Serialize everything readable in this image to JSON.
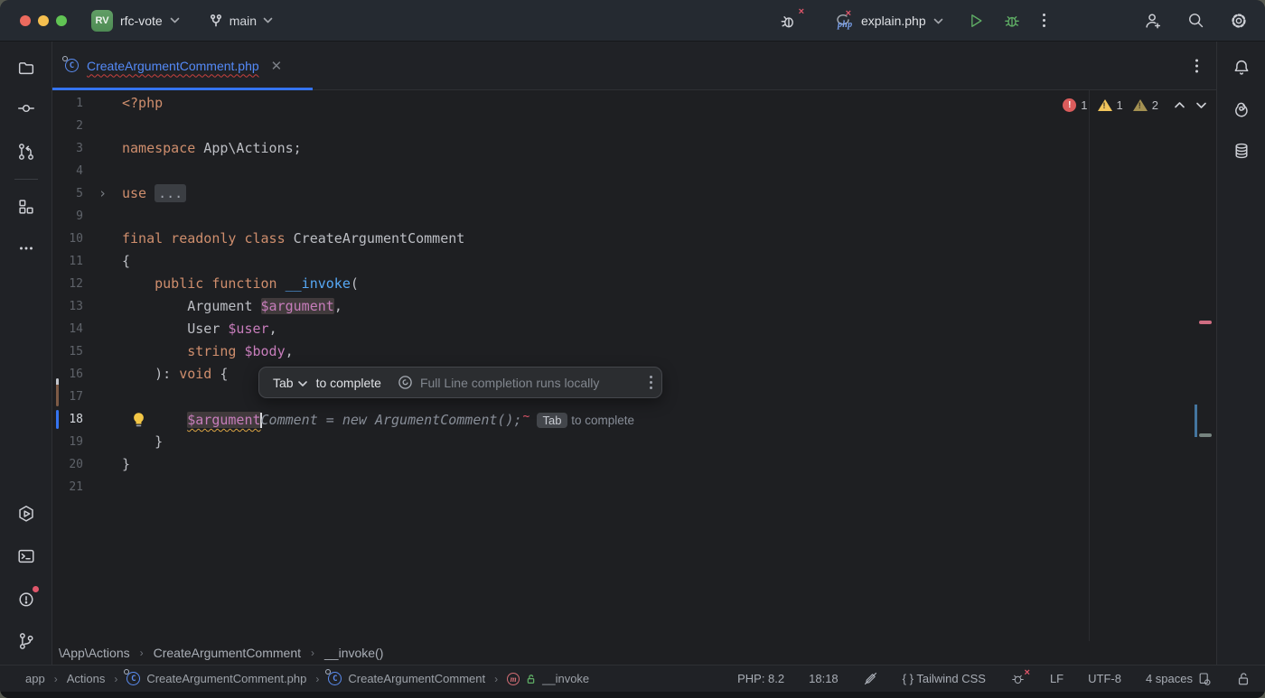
{
  "titlebar": {
    "project_badge": "RV",
    "project_name": "rfc-vote",
    "branch": "main",
    "run_config": "explain.php"
  },
  "tab": {
    "filename": "CreateArgumentComment.php"
  },
  "inspections": {
    "errors": "1",
    "warnings": "1",
    "weak_warnings": "2"
  },
  "completion_popup": {
    "key": "Tab",
    "action": "to complete",
    "note": "Full Line completion runs locally"
  },
  "editor": {
    "lines": [
      {
        "n": "1",
        "segs": [
          [
            "<?php",
            "kw"
          ]
        ]
      },
      {
        "n": "2",
        "segs": []
      },
      {
        "n": "3",
        "segs": [
          [
            "namespace",
            "kw"
          ],
          [
            " App\\Actions;",
            "txt"
          ]
        ]
      },
      {
        "n": "4",
        "segs": []
      },
      {
        "n": "5",
        "fold": true,
        "segs": [
          [
            "use",
            "kw"
          ],
          [
            " ",
            "txt"
          ],
          [
            "...",
            "foldbox"
          ]
        ]
      },
      {
        "n": "9",
        "segs": []
      },
      {
        "n": "10",
        "segs": [
          [
            "final readonly class",
            "kw"
          ],
          [
            " CreateArgumentComment",
            "txt"
          ]
        ]
      },
      {
        "n": "11",
        "segs": [
          [
            "{",
            "txt"
          ]
        ]
      },
      {
        "n": "12",
        "segs": [
          [
            "    ",
            "txt"
          ],
          [
            "public function",
            "kw"
          ],
          [
            " ",
            "txt"
          ],
          [
            "__invoke",
            "fn"
          ],
          [
            "(",
            "txt"
          ]
        ]
      },
      {
        "n": "13",
        "segs": [
          [
            "        Argument ",
            "txt"
          ],
          [
            "$argument",
            "var hl"
          ],
          [
            ",",
            "txt"
          ]
        ]
      },
      {
        "n": "14",
        "segs": [
          [
            "        User ",
            "txt"
          ],
          [
            "$user",
            "var"
          ],
          [
            ",",
            "txt"
          ]
        ]
      },
      {
        "n": "15",
        "segs": [
          [
            "        ",
            "txt"
          ],
          [
            "string",
            "kw"
          ],
          [
            " ",
            "txt"
          ],
          [
            "$body",
            "var"
          ],
          [
            ",",
            "txt"
          ]
        ]
      },
      {
        "n": "16",
        "segs": [
          [
            "    ): ",
            "txt"
          ],
          [
            "void",
            "kw"
          ],
          [
            " {",
            "txt"
          ]
        ]
      },
      {
        "n": "17",
        "marker": "change",
        "segs": []
      },
      {
        "n": "18",
        "marker": "caret",
        "active": true,
        "bulb": true,
        "segs": [
          [
            "        ",
            "txt"
          ],
          [
            "$argument",
            "var hl warn"
          ],
          [
            "",
            "caret"
          ],
          [
            "Comment = new ArgumentComment();",
            "ghost"
          ],
          [
            "",
            "redsq"
          ],
          [
            "Tab",
            "tabbadge"
          ],
          [
            " to complete",
            "hint"
          ]
        ]
      },
      {
        "n": "19",
        "segs": [
          [
            "    }",
            "txt"
          ]
        ]
      },
      {
        "n": "20",
        "segs": [
          [
            "}",
            "txt"
          ]
        ]
      },
      {
        "n": "21",
        "segs": []
      }
    ]
  },
  "sticky_breadcrumbs": [
    "\\App\\Actions",
    "CreateArgumentComment",
    "__invoke()"
  ],
  "navbar": [
    "app",
    "Actions",
    "CreateArgumentComment.php",
    "CreateArgumentComment",
    "__invoke"
  ],
  "status": {
    "php_version": "PHP: 8.2",
    "caret_position": "18:18",
    "tailwind": "{ } Tailwind CSS",
    "line_separator": "LF",
    "encoding": "UTF-8",
    "indent": "4 spaces"
  }
}
